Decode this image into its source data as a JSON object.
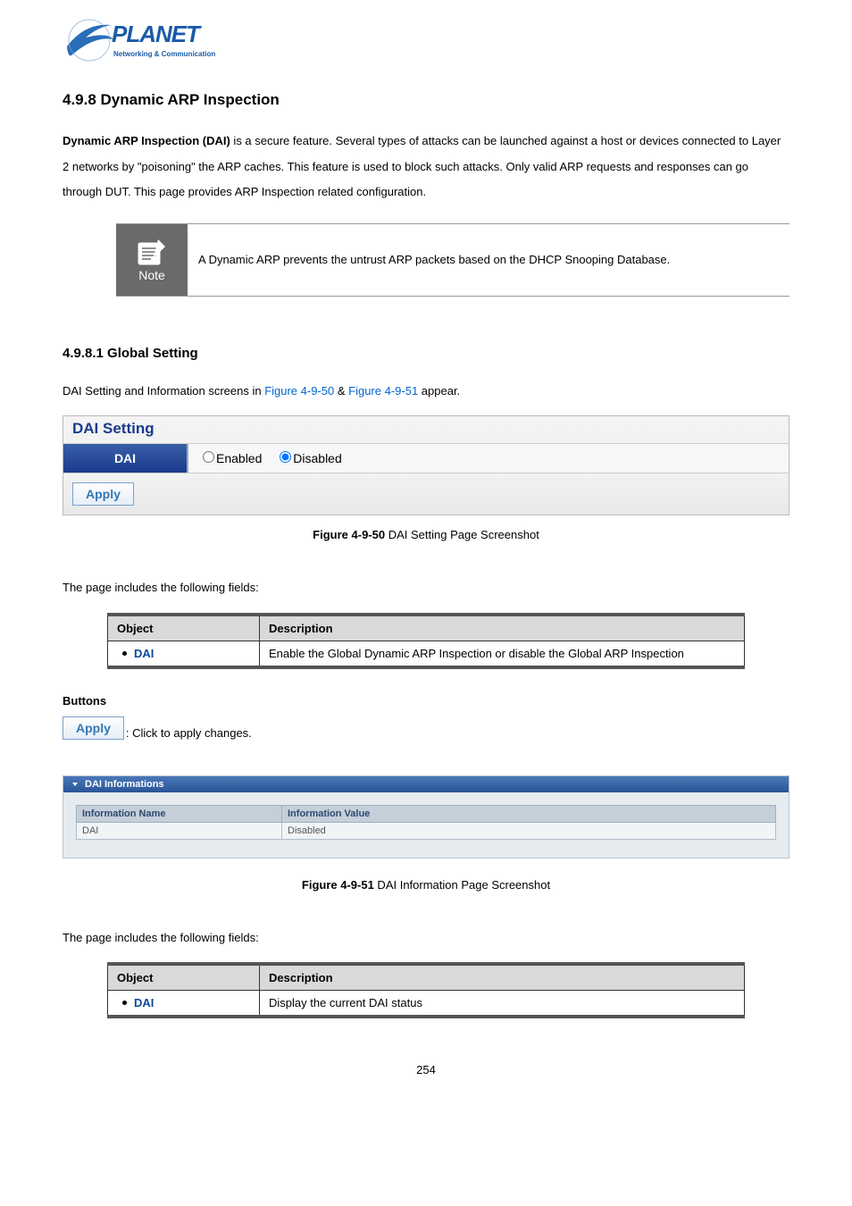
{
  "logo": {
    "name": "PLANET",
    "sub": "Networking & Communication"
  },
  "section": {
    "title": "4.9.8 Dynamic ARP Inspection",
    "intro_bold": "Dynamic ARP Inspection (DAI)",
    "intro_rest": " is a secure feature. Several types of attacks can be launched against a host or devices connected to Layer 2 networks by \"poisoning\" the ARP caches. This feature is used to block such attacks. Only valid ARP requests and responses can go through DUT. This page provides ARP Inspection related configuration."
  },
  "note": {
    "label": "Note",
    "text": "A Dynamic ARP prevents the untrust ARP packets based on the DHCP Snooping Database."
  },
  "subsection": {
    "title": "4.9.8.1 Global Setting",
    "lead_prefix": "DAI Setting and Information screens in ",
    "fig1_link": "Figure 4-9-50",
    "amp": " & ",
    "fig2_link": "Figure 4-9-51",
    "lead_suffix": " appear."
  },
  "dai_panel": {
    "title": "DAI Setting",
    "row_label": "DAI",
    "opt_enabled": "Enabled",
    "opt_disabled": "Disabled",
    "apply": "Apply"
  },
  "caption1": {
    "bold": "Figure 4-9-50",
    "rest": " DAI Setting Page Screenshot"
  },
  "fields_intro": "The page includes the following fields:",
  "fields_table1": {
    "h_obj": "Object",
    "h_desc": "Description",
    "rows": [
      {
        "obj": "DAI",
        "desc": "Enable the Global Dynamic ARP Inspection or disable the Global ARP Inspection"
      }
    ]
  },
  "buttons": {
    "heading": "Buttons",
    "apply": "Apply",
    "apply_desc": ": Click to apply changes."
  },
  "info_panel": {
    "title": "DAI Informations",
    "h_name": "Information Name",
    "h_value": "Information Value",
    "rows": [
      {
        "name": "DAI",
        "value": "Disabled"
      }
    ]
  },
  "caption2": {
    "bold": "Figure 4-9-51",
    "rest": " DAI Information Page Screenshot"
  },
  "fields_intro2": "The page includes the following fields:",
  "fields_table2": {
    "h_obj": "Object",
    "h_desc": "Description",
    "rows": [
      {
        "obj": "DAI",
        "desc": "Display the current DAI status"
      }
    ]
  },
  "page_number": "254"
}
